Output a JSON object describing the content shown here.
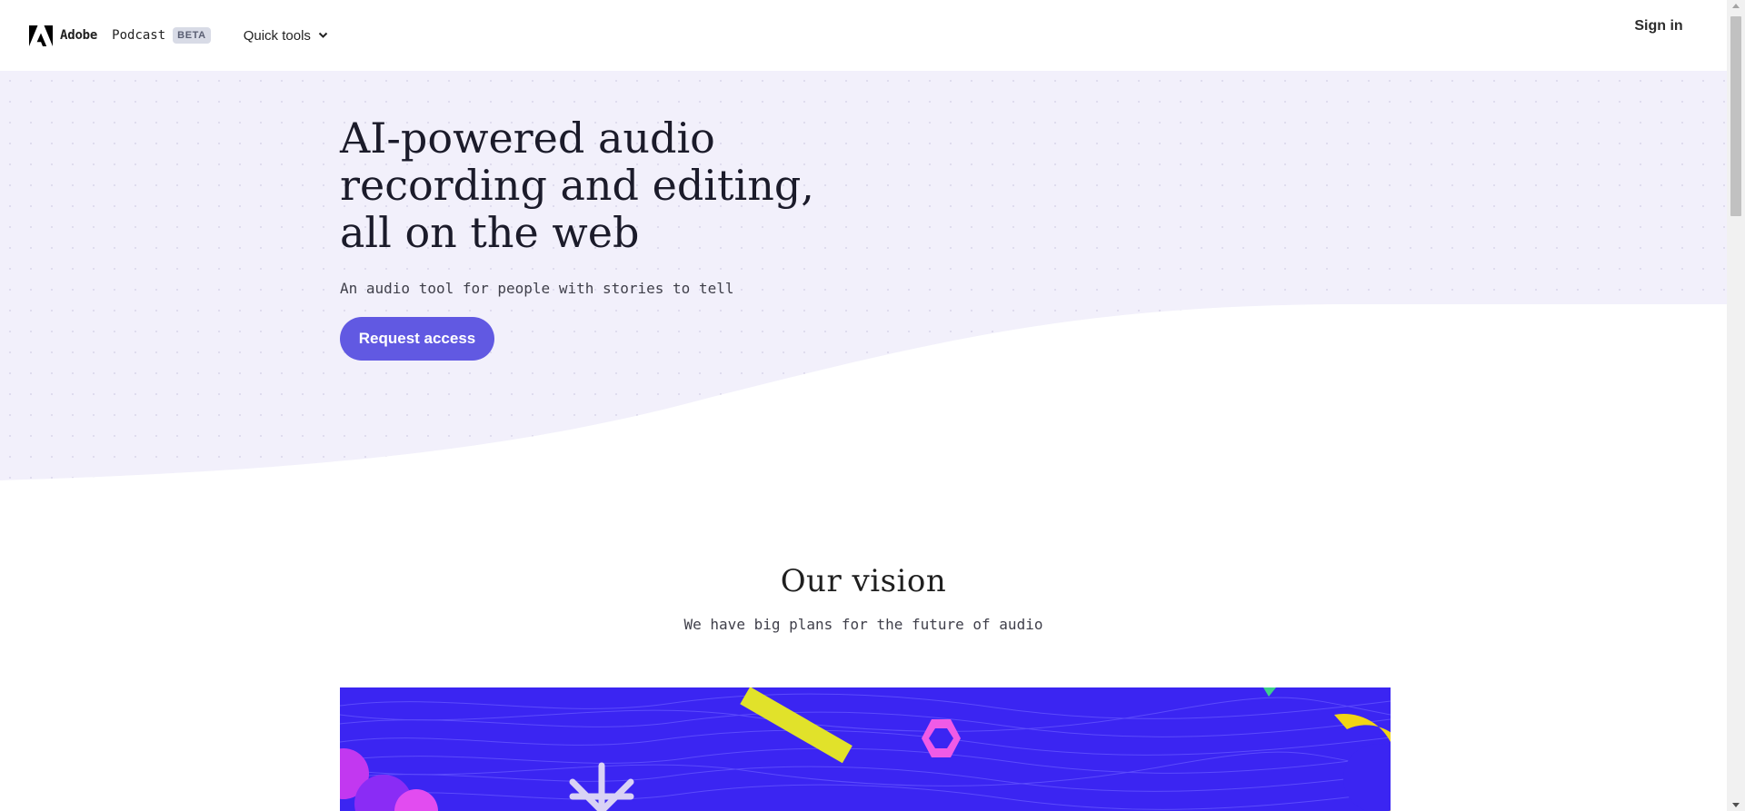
{
  "header": {
    "brand": "Adobe",
    "product": "Podcast",
    "badge": "BETA",
    "quick_tools_label": "Quick tools",
    "sign_in_label": "Sign in",
    "logo_icon": "adobe-logo-icon",
    "dropdown_icon": "chevron-down-icon"
  },
  "hero": {
    "title": "AI-powered audio recording and editing, all on the web",
    "subtitle": "An audio tool for people with stories to tell",
    "cta_label": "Request access"
  },
  "vision": {
    "title": "Our vision",
    "subtitle": "We have big plans for the future of audio"
  },
  "colors": {
    "hero_bg": "#f2f0fb",
    "cta": "#6159e2",
    "banner_bg": "#3b25f2",
    "badge_bg": "#d8dbe6"
  }
}
